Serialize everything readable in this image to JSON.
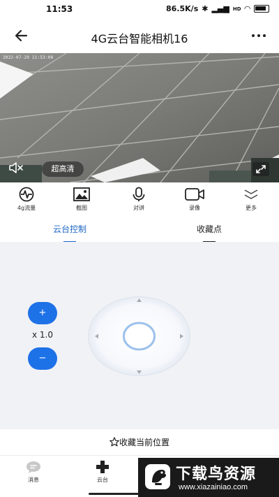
{
  "status_bar": {
    "time": "11:53",
    "network_speed": "86.5K/s",
    "signal_badge": "HD"
  },
  "header": {
    "title": "4G云台智能相机16",
    "back_icon": "arrow-left-icon",
    "more_icon": "more-dots-icon"
  },
  "video": {
    "timestamp": "2022-07-29 11:53:08",
    "quality_label": "超高清",
    "mute_icon": "speaker-muted-icon",
    "fullscreen_icon": "expand-icon"
  },
  "toolbar": {
    "items": [
      {
        "label": "4g流量",
        "icon": "signal-wave-icon"
      },
      {
        "label": "截图",
        "icon": "image-icon"
      },
      {
        "label": "对讲",
        "icon": "microphone-icon"
      },
      {
        "label": "录像",
        "icon": "video-camera-icon"
      },
      {
        "label": "更多",
        "icon": "chevron-double-down-icon"
      }
    ]
  },
  "tabs": [
    {
      "label": "云台控制",
      "active": true
    },
    {
      "label": "收藏点",
      "active": false
    }
  ],
  "ptz": {
    "zoom_in_label": "+",
    "zoom_out_label": "−",
    "zoom_value": "x 1.0",
    "joystick_icon": "directional-pad-icon"
  },
  "favorites": {
    "save_label": "收藏当前位置",
    "save_icon": "star-outline-icon"
  },
  "bottom_nav": {
    "items": [
      {
        "label": "消息",
        "icon": "chat-bubble-icon"
      },
      {
        "label": "云台",
        "icon": "dpad-cross-icon"
      }
    ]
  },
  "watermark": {
    "title": "下载鸟资源",
    "url": "www.xiazainiao.com"
  },
  "colors": {
    "accent": "#1d66c4",
    "button_blue": "#1e72e8",
    "panel_bg": "#f1f2f6"
  }
}
